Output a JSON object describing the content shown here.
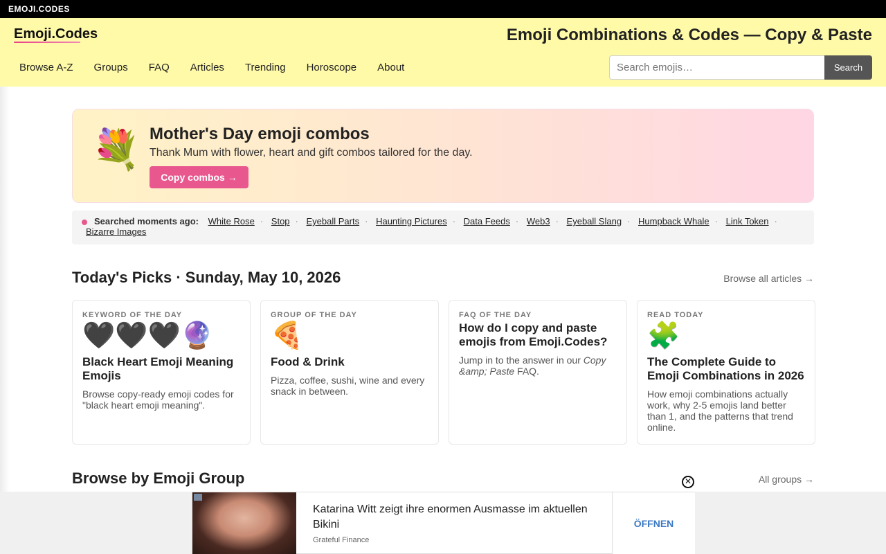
{
  "topbar": {
    "brand": "EMOJI.CODES"
  },
  "header": {
    "logo": "Emoji.Codes",
    "heading": "Emoji Combinations & Codes — Copy & Paste",
    "nav": [
      "Browse A-Z",
      "Groups",
      "FAQ",
      "Articles",
      "Trending",
      "Horoscope",
      "About"
    ],
    "search_placeholder": "Search emojis…",
    "search_button": "Search"
  },
  "hero": {
    "emoji": "💐",
    "title": "Mother's Day emoji combos",
    "subtitle": "Thank Mum with flower, heart and gift combos tailored for the day.",
    "button": "Copy combos →"
  },
  "searched": {
    "label": "Searched moments ago:",
    "items": [
      "White Rose",
      "Stop",
      "Eyeball Parts",
      "Haunting Pictures",
      "Data Feeds",
      "Web3",
      "Eyeball Slang",
      "Humpback Whale",
      "Link Token",
      "Bizarre Images"
    ]
  },
  "picks": {
    "title": "Today's Picks · Sunday, May 10, 2026",
    "link": "Browse all articles →",
    "cards": [
      {
        "kicker": "KEYWORD OF THE DAY",
        "emoji": "🖤🖤🖤🔮",
        "title": "Black Heart Emoji Meaning Emojis",
        "desc": "Browse copy-ready emoji codes for \"black heart emoji meaning\"."
      },
      {
        "kicker": "GROUP OF THE DAY",
        "emoji": "🍕",
        "title": "Food & Drink",
        "desc": "Pizza, coffee, sushi, wine and every snack in between."
      },
      {
        "kicker": "FAQ OF THE DAY",
        "emoji": "",
        "title": "How do I copy and paste emojis from Emoji.Codes?",
        "desc_prefix": "Jump in to the answer in our ",
        "desc_em": "Copy &amp; Paste",
        "desc_suffix": " FAQ."
      },
      {
        "kicker": "READ TODAY",
        "emoji": "🧩",
        "title": "The Complete Guide to Emoji Combinations in 2026",
        "desc": "How emoji combinations actually work, why 2-5 emojis land better than 1, and the patterns that trend online."
      }
    ]
  },
  "groups": {
    "title": "Browse by Emoji Group",
    "link": "All groups →"
  },
  "ad": {
    "headline": "Katarina Witt zeigt ihre enormen Ausmasse im aktuellen Bikini",
    "source": "Grateful Finance",
    "cta": "ÖFFNEN",
    "close": "✕"
  }
}
